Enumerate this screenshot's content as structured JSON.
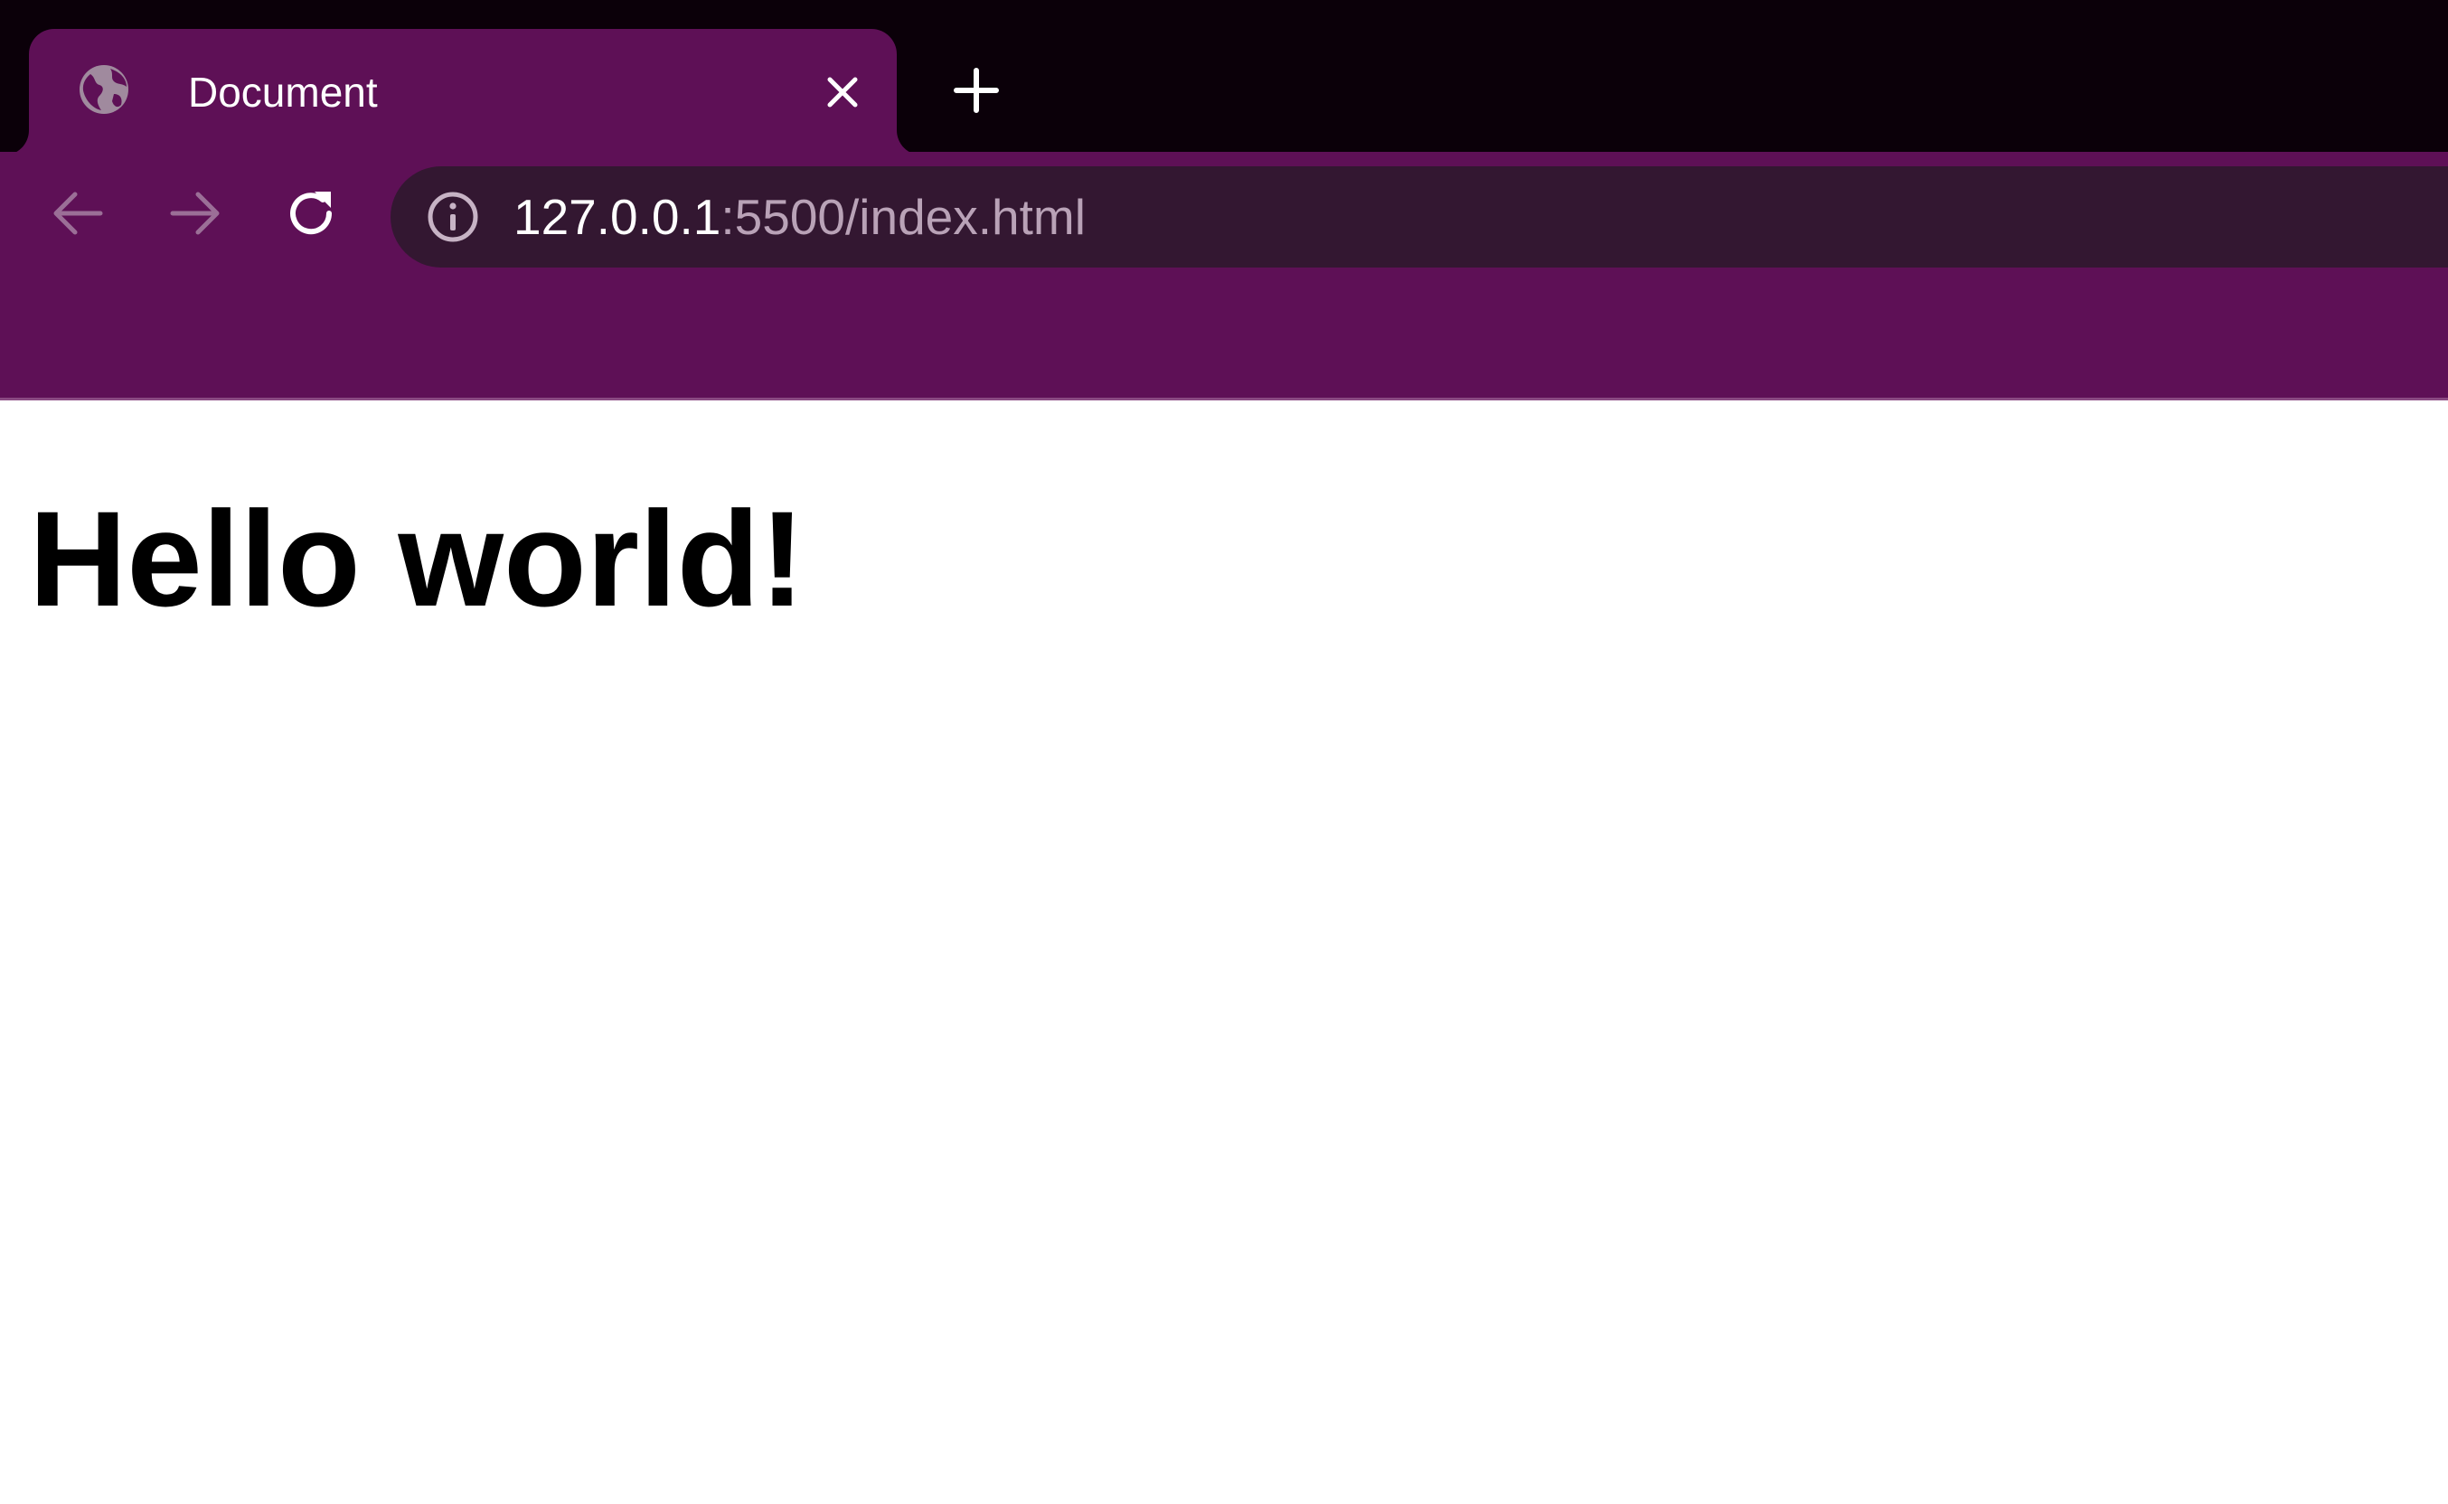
{
  "browser": {
    "tab": {
      "title": "Document",
      "favicon_icon": "globe-icon",
      "close_icon": "close-icon"
    },
    "new_tab_icon": "plus-icon",
    "toolbar": {
      "back_icon": "arrow-left-icon",
      "forward_icon": "arrow-right-icon",
      "reload_icon": "reload-icon",
      "site_info_icon": "info-icon"
    },
    "address_bar": {
      "host": "127.0.0.1",
      "path": ":5500/index.html"
    },
    "colors": {
      "tabstrip": "#0b0009",
      "toolbar": "#5e1056",
      "omnibox": "#331731",
      "url_host": "#ffffff",
      "url_path": "#b9a2b7"
    }
  },
  "page": {
    "heading": "Hello world!"
  }
}
